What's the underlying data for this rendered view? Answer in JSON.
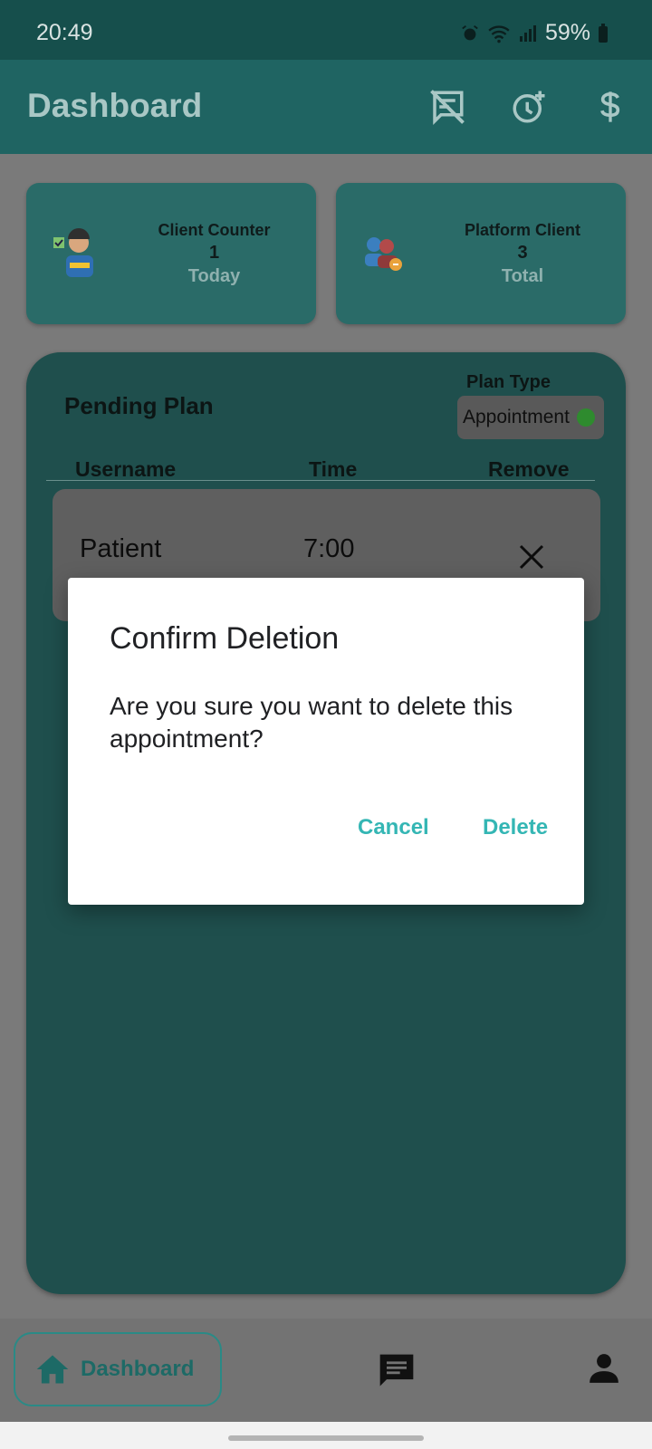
{
  "status_bar": {
    "time": "20:49",
    "battery": "59%"
  },
  "app_bar": {
    "title": "Dashboard",
    "icons": [
      "speaker-notes-off-icon",
      "alarm-add-icon",
      "dollar-icon"
    ]
  },
  "stats": {
    "client_counter": {
      "label": "Client Counter",
      "value": "1",
      "sub": "Today"
    },
    "platform_client": {
      "label": "Platform Client",
      "value": "3",
      "sub": "Total"
    }
  },
  "pending": {
    "title": "Pending Plan",
    "plan_type_label": "Plan Type",
    "plan_type_value": "Appointment",
    "columns": [
      "Username",
      "Time",
      "Remove"
    ],
    "rows": [
      {
        "username": "Patient",
        "time": "7:00"
      }
    ]
  },
  "dialog": {
    "title": "Confirm Deletion",
    "message": "Are you sure you want to delete this appointment?",
    "cancel": "Cancel",
    "delete": "Delete"
  },
  "bottom_nav": {
    "home_label": "Dashboard"
  },
  "colors": {
    "accent": "#34b6b4",
    "app_bar": "#1f6462",
    "status_dot": "#2e8b2e"
  }
}
